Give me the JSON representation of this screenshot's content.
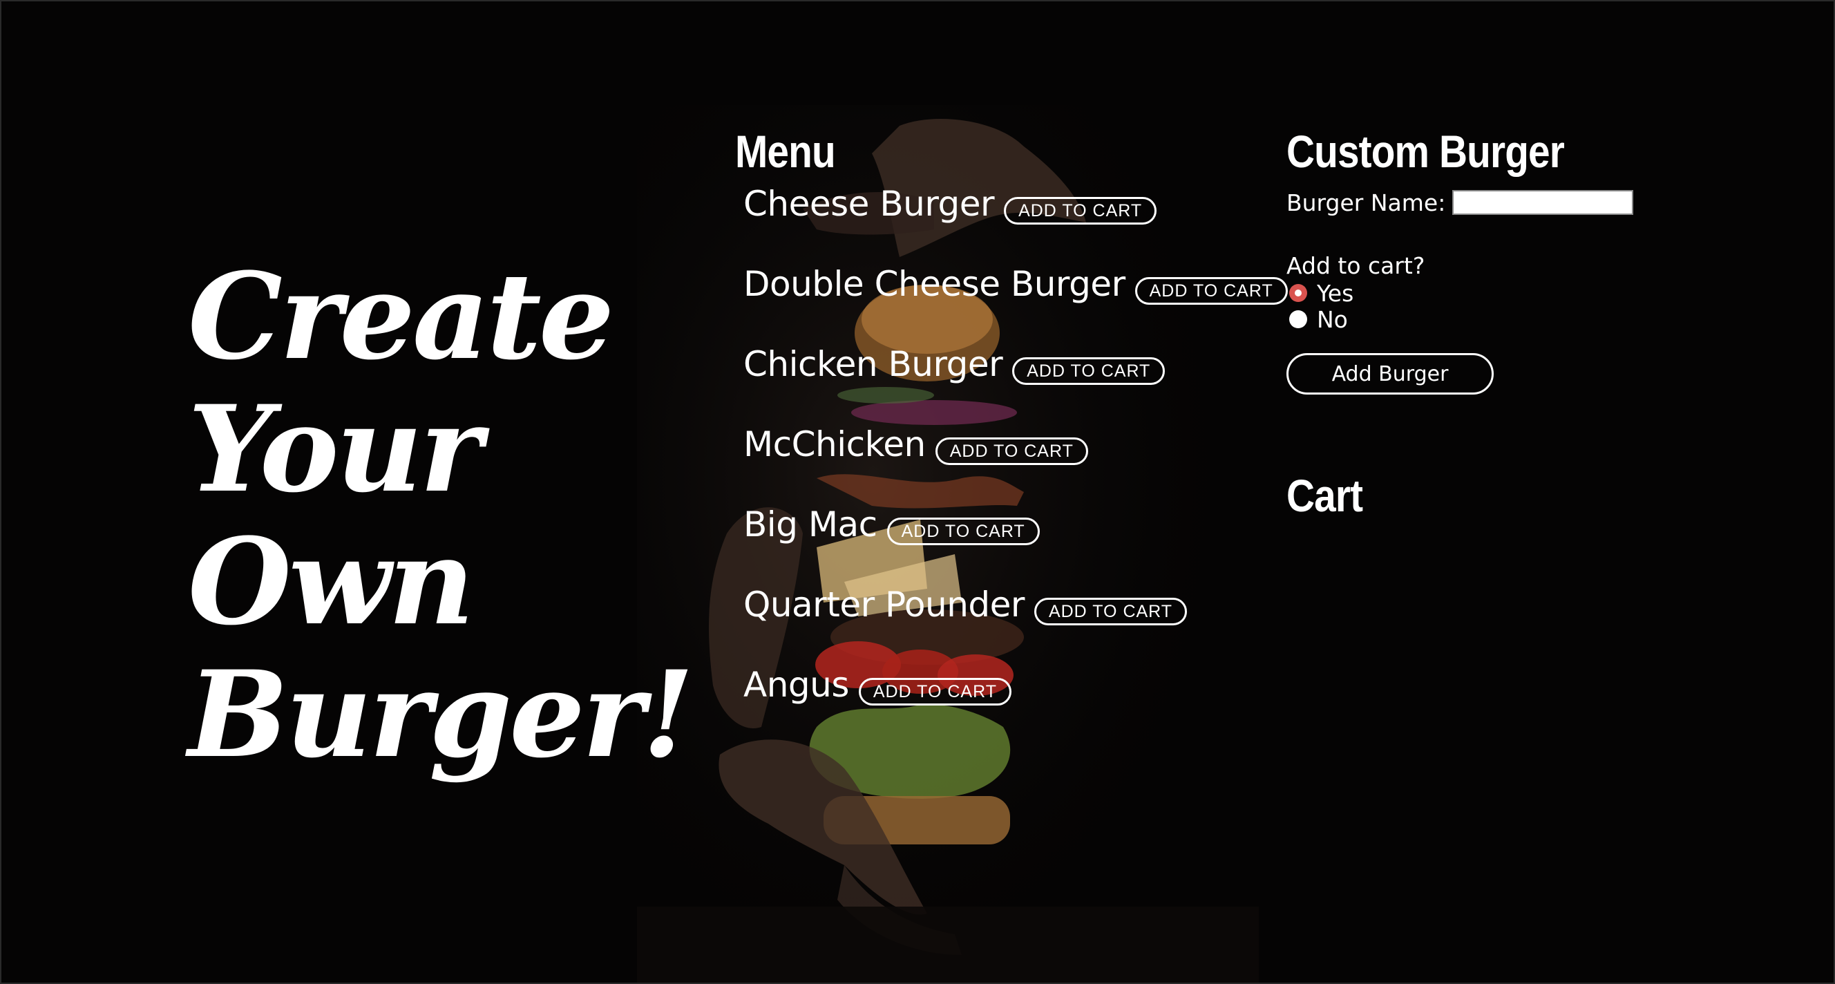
{
  "hero": {
    "lines": [
      "Create",
      "Your",
      "Own",
      "Burger!"
    ]
  },
  "menu": {
    "title": "Menu",
    "button_label": "ADD TO CART",
    "items": [
      {
        "name": "Cheese Burger"
      },
      {
        "name": "Double Cheese Burger"
      },
      {
        "name": "Chicken Burger"
      },
      {
        "name": "McChicken"
      },
      {
        "name": "Big Mac"
      },
      {
        "name": "Quarter Pounder"
      },
      {
        "name": "Angus"
      }
    ]
  },
  "custom": {
    "title": "Custom Burger",
    "name_label": "Burger Name:",
    "name_value": "",
    "question": "Add to cart?",
    "options": [
      {
        "label": "Yes",
        "checked": true
      },
      {
        "label": "No",
        "checked": false
      }
    ],
    "submit_label": "Add Burger"
  },
  "cart": {
    "title": "Cart"
  },
  "colors": {
    "background": "#050404",
    "text": "#ffffff",
    "radio_checked": "#d9534f"
  }
}
